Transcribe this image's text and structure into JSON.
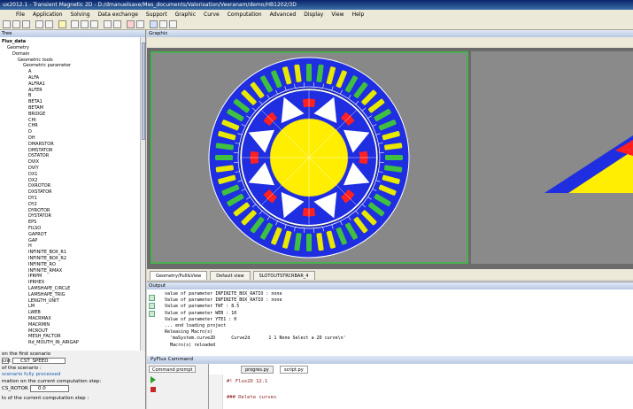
{
  "window": {
    "title": "ux2012.1 - Transient Magnetic 2D - D:/dmanuelsave/Mes_documents/Valorisation/Veeranam/demo/HB1202/3D"
  },
  "menu": [
    "File",
    "Application",
    "Solving",
    "Data exchange",
    "Support",
    "Graphic",
    "Curve",
    "Computation",
    "Advanced",
    "Display",
    "View",
    "Help"
  ],
  "tree": {
    "header": "Tree",
    "root": "Flux_data",
    "items": [
      "Geometry",
      "Domain",
      "Geometric tools",
      "Geometric parameter",
      "A",
      "ALFA",
      "ALFRA1",
      "ALFER",
      "B",
      "BETA1",
      "BETAM",
      "BRIDGE",
      "CHI",
      "CHR",
      "D",
      "DH",
      "DMARSTOR",
      "DMSTATOR",
      "DSTATOR",
      "DVIX",
      "DVIY",
      "DX1",
      "DX2",
      "DXROTOR",
      "DXSTATOR",
      "DY1",
      "DY2",
      "DYROTOR",
      "DYSTATOR",
      "EPS",
      "FILSO",
      "GAPROT",
      "GAP",
      "H",
      "INFINITE_BOX_R1",
      "INFINITE_BOX_R2",
      "INFINITE_RO",
      "INFINITE_RMAX",
      "IPRPM",
      "IPRHEX",
      "LAMSHAPE_CIRCLE",
      "LAMSHAPE_TRIG",
      "LENGTH_UNIT",
      "LM",
      "LWEB",
      "MACRMAX",
      "MACRMIN",
      "MCROUT",
      "MESH_FACTOR",
      "Rd_MOUTH_IN_AIRGAP"
    ]
  },
  "scenario": {
    "line1": "on the first scenario",
    "field1_label": "cnt",
    "field1_value": "CST_SPEED",
    "line2": "of the scenario :",
    "status": "scenario fully processed",
    "line3": "mation on the current computation step:",
    "field2_label": "CS_ROTOR :",
    "field2_value": "0.0",
    "line4": "ts of the current computation step :"
  },
  "graphic": {
    "header": "Graphic",
    "tabs": [
      "Geometry/Pull&View",
      "Default view",
      "SLOTOUTSTRCRBAR_4"
    ]
  },
  "output": {
    "header": "Output",
    "lines": [
      "value of parameter INFINITE_BOX_RATIO : none",
      "Value of parameter INFINITE_BOX_RATIO : none",
      "Value of parameter TWT : 8.5",
      "Value of parameter WEB : 10",
      "Value of parameter YTE1 : 0",
      "... end loading project",
      "Releasing Macro(s)",
      "  'maSystem.curve2D      Curve2d       1 1 None Select a 2D curve\\n'",
      "  Macro(s) reloaded"
    ]
  },
  "pyflux": {
    "header": "PyFlux Command",
    "left_tab": "Command prompt",
    "editor_tabs": [
      "progres.py",
      "script.py"
    ],
    "code_lines": [
      "#! Flux2D 12.1",
      "",
      "### Delete curves"
    ]
  },
  "colors": {
    "stator_blue": "#1e2ee0",
    "rotor_yellow": "#ffee00",
    "magnet_red": "#ff2020",
    "coil_green": "#40c040",
    "coil_yellow": "#e8e800",
    "active_border": "#4caf50"
  }
}
